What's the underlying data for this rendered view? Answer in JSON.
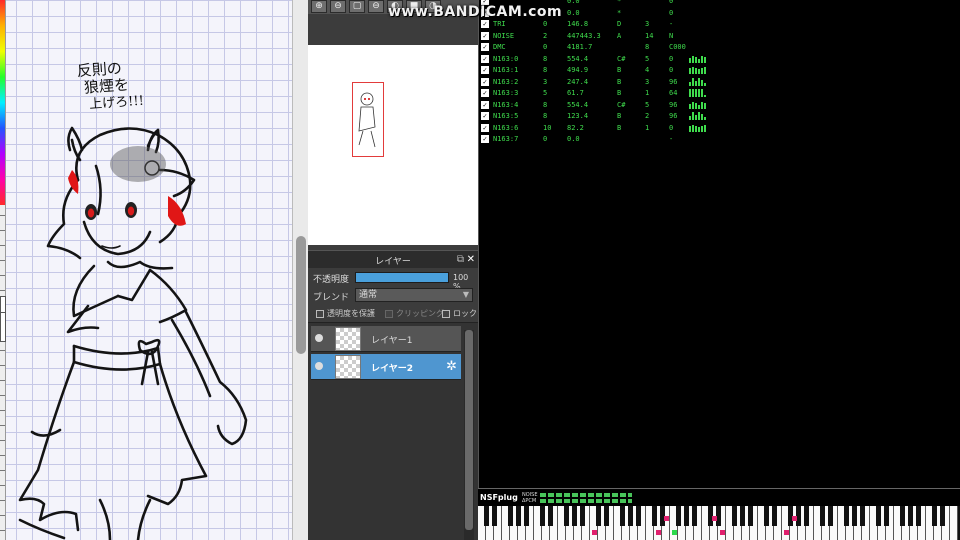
{
  "watermark": "www.BANDICAM.com",
  "canvas": {
    "note_text": [
      "反則の",
      "狼煙を",
      "上げろ!!!"
    ]
  },
  "navigator_toolbar": [
    "⊕",
    "⊖",
    "▢",
    "⊖",
    "◐",
    "■",
    "◑"
  ],
  "layer_panel": {
    "title": "レイヤー",
    "opacity_label": "不透明度",
    "opacity_value": "100 %",
    "opacity_fraction": 1.0,
    "blend_label": "ブレンド",
    "blend_value": "通常",
    "protect_label": "透明度を保護",
    "clip_label": "クリッピング",
    "lock_label": "ロック",
    "layers": [
      {
        "name": "レイヤー1",
        "selected": false
      },
      {
        "name": "レイヤー2",
        "selected": true
      }
    ],
    "selected_color": "#4f96d0"
  },
  "tracker": {
    "text_color": "#3fdc4d",
    "rows": [
      {
        "name": "",
        "vol": "",
        "freq": "0.0",
        "note": "*",
        "oct": "",
        "inst": "0"
      },
      {
        "name": "",
        "vol": "",
        "freq": "0.0",
        "note": "*",
        "oct": "",
        "inst": "0"
      },
      {
        "name": "TRI",
        "vol": "0",
        "freq": "146.8",
        "note": "D",
        "oct": "3",
        "inst": "-"
      },
      {
        "name": "NOISE",
        "vol": "2",
        "freq": "447443.3",
        "note": "A",
        "oct": "14",
        "inst": "N"
      },
      {
        "name": "DMC",
        "vol": "0",
        "freq": "4181.7",
        "note": "",
        "oct": "8",
        "inst": "C000"
      },
      {
        "name": "N163:0",
        "vol": "8",
        "freq": "554.4",
        "note": "C#",
        "oct": "5",
        "inst": "0"
      },
      {
        "name": "N163:1",
        "vol": "8",
        "freq": "494.9",
        "note": "B",
        "oct": "4",
        "inst": "0"
      },
      {
        "name": "N163:2",
        "vol": "3",
        "freq": "247.4",
        "note": "B",
        "oct": "3",
        "inst": "96"
      },
      {
        "name": "N163:3",
        "vol": "5",
        "freq": "61.7",
        "note": "B",
        "oct": "1",
        "inst": "64"
      },
      {
        "name": "N163:4",
        "vol": "8",
        "freq": "554.4",
        "note": "C#",
        "oct": "5",
        "inst": "96"
      },
      {
        "name": "N163:5",
        "vol": "8",
        "freq": "123.4",
        "note": "B",
        "oct": "2",
        "inst": "96"
      },
      {
        "name": "N163:6",
        "vol": "10",
        "freq": "82.2",
        "note": "B",
        "oct": "1",
        "inst": "0"
      },
      {
        "name": "N163:7",
        "vol": "0",
        "freq": "0.0",
        "note": "",
        "oct": "",
        "inst": "-"
      }
    ]
  },
  "nsf_bar": {
    "label": "NSFplug",
    "meter_labels": [
      "NOISE",
      "ΔPCM"
    ]
  }
}
